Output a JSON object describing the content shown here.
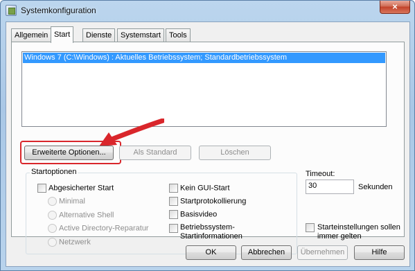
{
  "window": {
    "title": "Systemkonfiguration",
    "close_glyph": "×"
  },
  "tabs": [
    {
      "label": "Allgemein"
    },
    {
      "label": "Start"
    },
    {
      "label": "Dienste"
    },
    {
      "label": "Systemstart"
    },
    {
      "label": "Tools"
    }
  ],
  "active_tab": "Start",
  "os_list": {
    "items": [
      "Windows 7 (C:\\Windows) : Aktuelles Betriebssystem; Standardbetriebssystem"
    ]
  },
  "list_buttons": {
    "advanced": "Erweiterte Optionen...",
    "set_default": "Als Standard",
    "delete": "Löschen"
  },
  "start_options": {
    "title": "Startoptionen",
    "safe_boot": "Abgesicherter Start",
    "minimal": "Minimal",
    "alt_shell": "Alternative Shell",
    "ad_repair": "Active Directory-Reparatur",
    "network": "Netzwerk",
    "no_gui": "Kein GUI-Start",
    "boot_log": "Startprotokollierung",
    "base_video": "Basisvideo",
    "os_boot_info_1": "Betriebssystem-",
    "os_boot_info_2": "Startinformationen"
  },
  "timeout": {
    "label": "Timeout:",
    "value": "30",
    "unit": "Sekunden"
  },
  "permanent": {
    "line1": "Starteinstellungen sollen",
    "line2": "immer gelten"
  },
  "dialog_buttons": {
    "ok": "OK",
    "cancel": "Abbrechen",
    "apply": "Übernehmen",
    "help": "Hilfe"
  },
  "colors": {
    "selection": "#3399ff",
    "annotation_red": "#d9262b"
  }
}
